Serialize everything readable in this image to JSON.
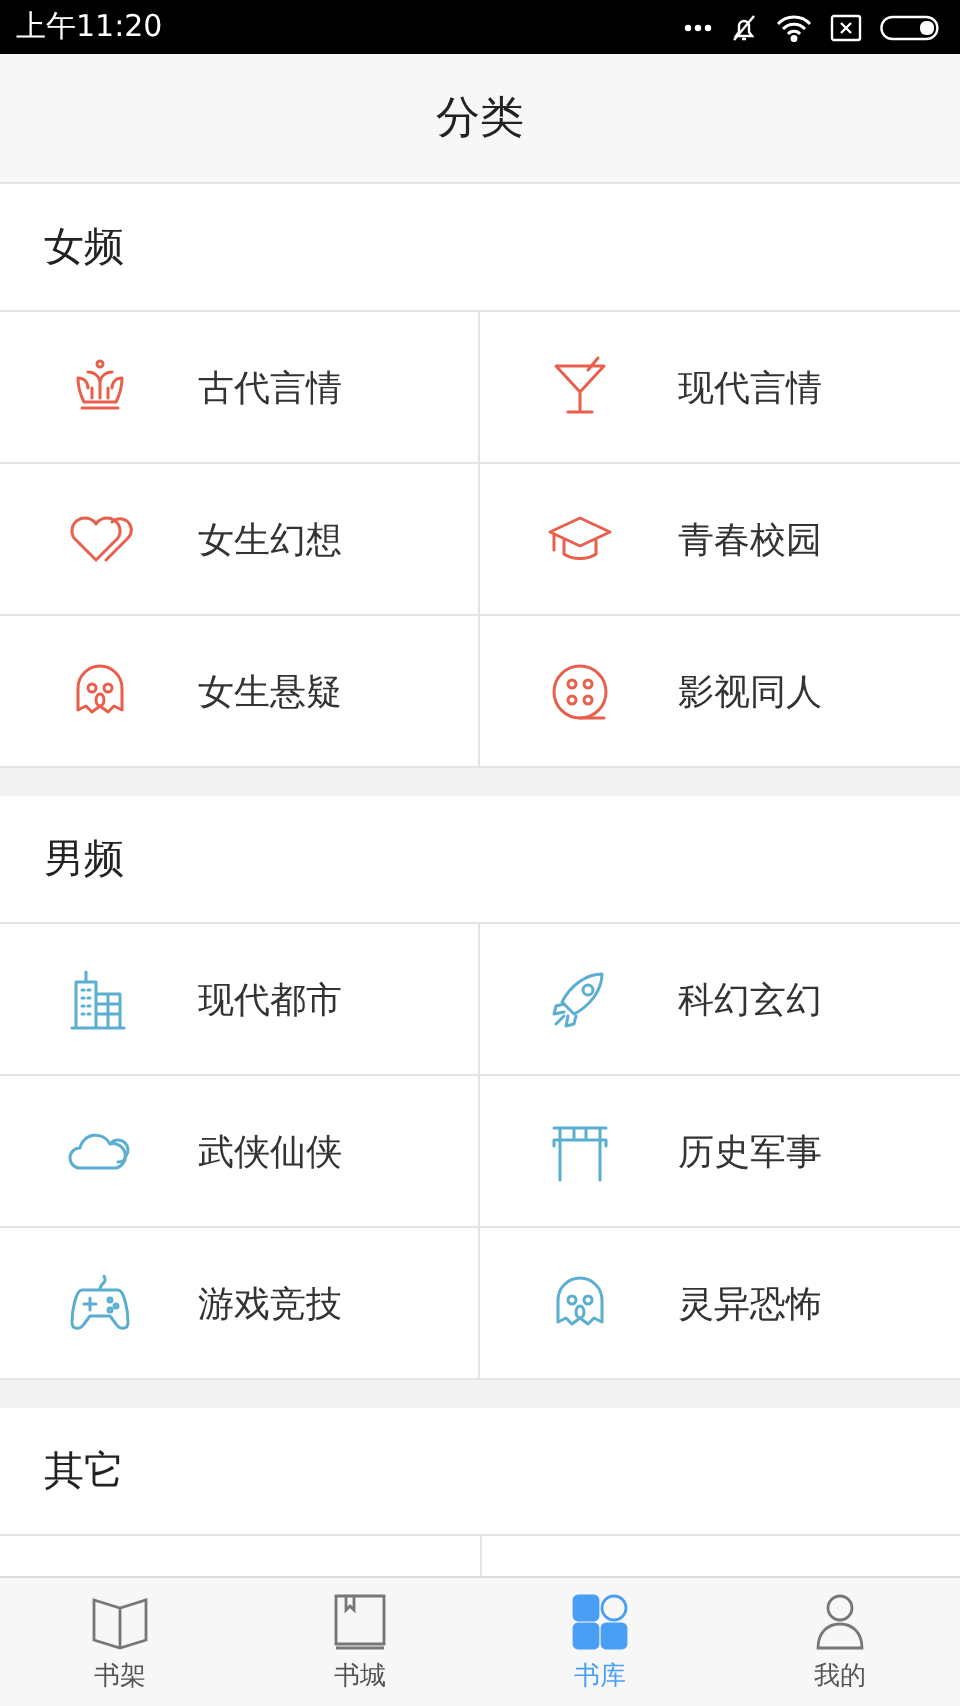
{
  "status_bar": {
    "time": "上午11:20"
  },
  "header": {
    "title": "分类"
  },
  "sections": [
    {
      "title": "女频",
      "color": "#e8604c",
      "items": [
        {
          "label": "古代言情"
        },
        {
          "label": "现代言情"
        },
        {
          "label": "女生幻想"
        },
        {
          "label": "青春校园"
        },
        {
          "label": "女生悬疑"
        },
        {
          "label": "影视同人"
        }
      ]
    },
    {
      "title": "男频",
      "color": "#5aaed0",
      "items": [
        {
          "label": "现代都市"
        },
        {
          "label": "科幻玄幻"
        },
        {
          "label": "武侠仙侠"
        },
        {
          "label": "历史军事"
        },
        {
          "label": "游戏竞技"
        },
        {
          "label": "灵异恐怖"
        }
      ]
    },
    {
      "title": "其它"
    }
  ],
  "tabs": [
    {
      "label": "书架",
      "selected": false
    },
    {
      "label": "书城",
      "selected": false
    },
    {
      "label": "书库",
      "selected": true
    },
    {
      "label": "我的",
      "selected": false
    }
  ]
}
